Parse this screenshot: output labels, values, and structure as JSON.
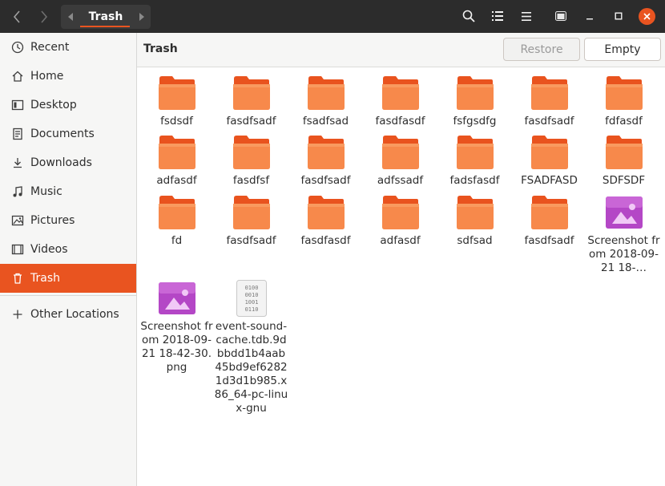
{
  "window": {
    "path_label": "Trash",
    "accent_color": "#e95420"
  },
  "sidebar": {
    "items": [
      {
        "label": "Recent",
        "icon": "clock-icon"
      },
      {
        "label": "Home",
        "icon": "home-icon"
      },
      {
        "label": "Desktop",
        "icon": "desktop-icon"
      },
      {
        "label": "Documents",
        "icon": "document-icon"
      },
      {
        "label": "Downloads",
        "icon": "download-icon"
      },
      {
        "label": "Music",
        "icon": "music-icon"
      },
      {
        "label": "Pictures",
        "icon": "picture-icon"
      },
      {
        "label": "Videos",
        "icon": "video-icon"
      },
      {
        "label": "Trash",
        "icon": "trash-icon",
        "active": true
      }
    ],
    "other_locations": {
      "label": "Other Locations",
      "icon": "plus-icon"
    }
  },
  "actionbar": {
    "title": "Trash",
    "restore_label": "Restore",
    "empty_label": "Empty"
  },
  "files": [
    {
      "name": "fsdsdf",
      "type": "folder"
    },
    {
      "name": "fasdfsadf",
      "type": "folder"
    },
    {
      "name": "fsadfsad",
      "type": "folder"
    },
    {
      "name": "fasdfasdf",
      "type": "folder"
    },
    {
      "name": "fsfgsdfg",
      "type": "folder"
    },
    {
      "name": "fasdfsadf",
      "type": "folder"
    },
    {
      "name": "fdfasdf",
      "type": "folder"
    },
    {
      "name": "adfasdf",
      "type": "folder"
    },
    {
      "name": "fasdfsf",
      "type": "folder"
    },
    {
      "name": "fasdfsadf",
      "type": "folder"
    },
    {
      "name": "adfssadf",
      "type": "folder"
    },
    {
      "name": "fadsfasdf",
      "type": "folder"
    },
    {
      "name": "FSADFASD",
      "type": "folder"
    },
    {
      "name": "SDFSDF",
      "type": "folder"
    },
    {
      "name": "fd",
      "type": "folder"
    },
    {
      "name": "fasdfsadf",
      "type": "folder"
    },
    {
      "name": "fasdfasdf",
      "type": "folder"
    },
    {
      "name": "adfasdf",
      "type": "folder"
    },
    {
      "name": "sdfsad",
      "type": "folder"
    },
    {
      "name": "fasdfsadf",
      "type": "folder"
    },
    {
      "name": "Screenshot from 2018-09-21 18-…",
      "type": "image"
    },
    {
      "name": "Screenshot from 2018-09-21 18-42-30.png",
      "type": "image"
    },
    {
      "name": "event-sound-cache.tdb.9dbbdd1b4aab45bd9ef62821d3d1b985.x86_64-pc-linux-gnu",
      "type": "binary"
    }
  ]
}
